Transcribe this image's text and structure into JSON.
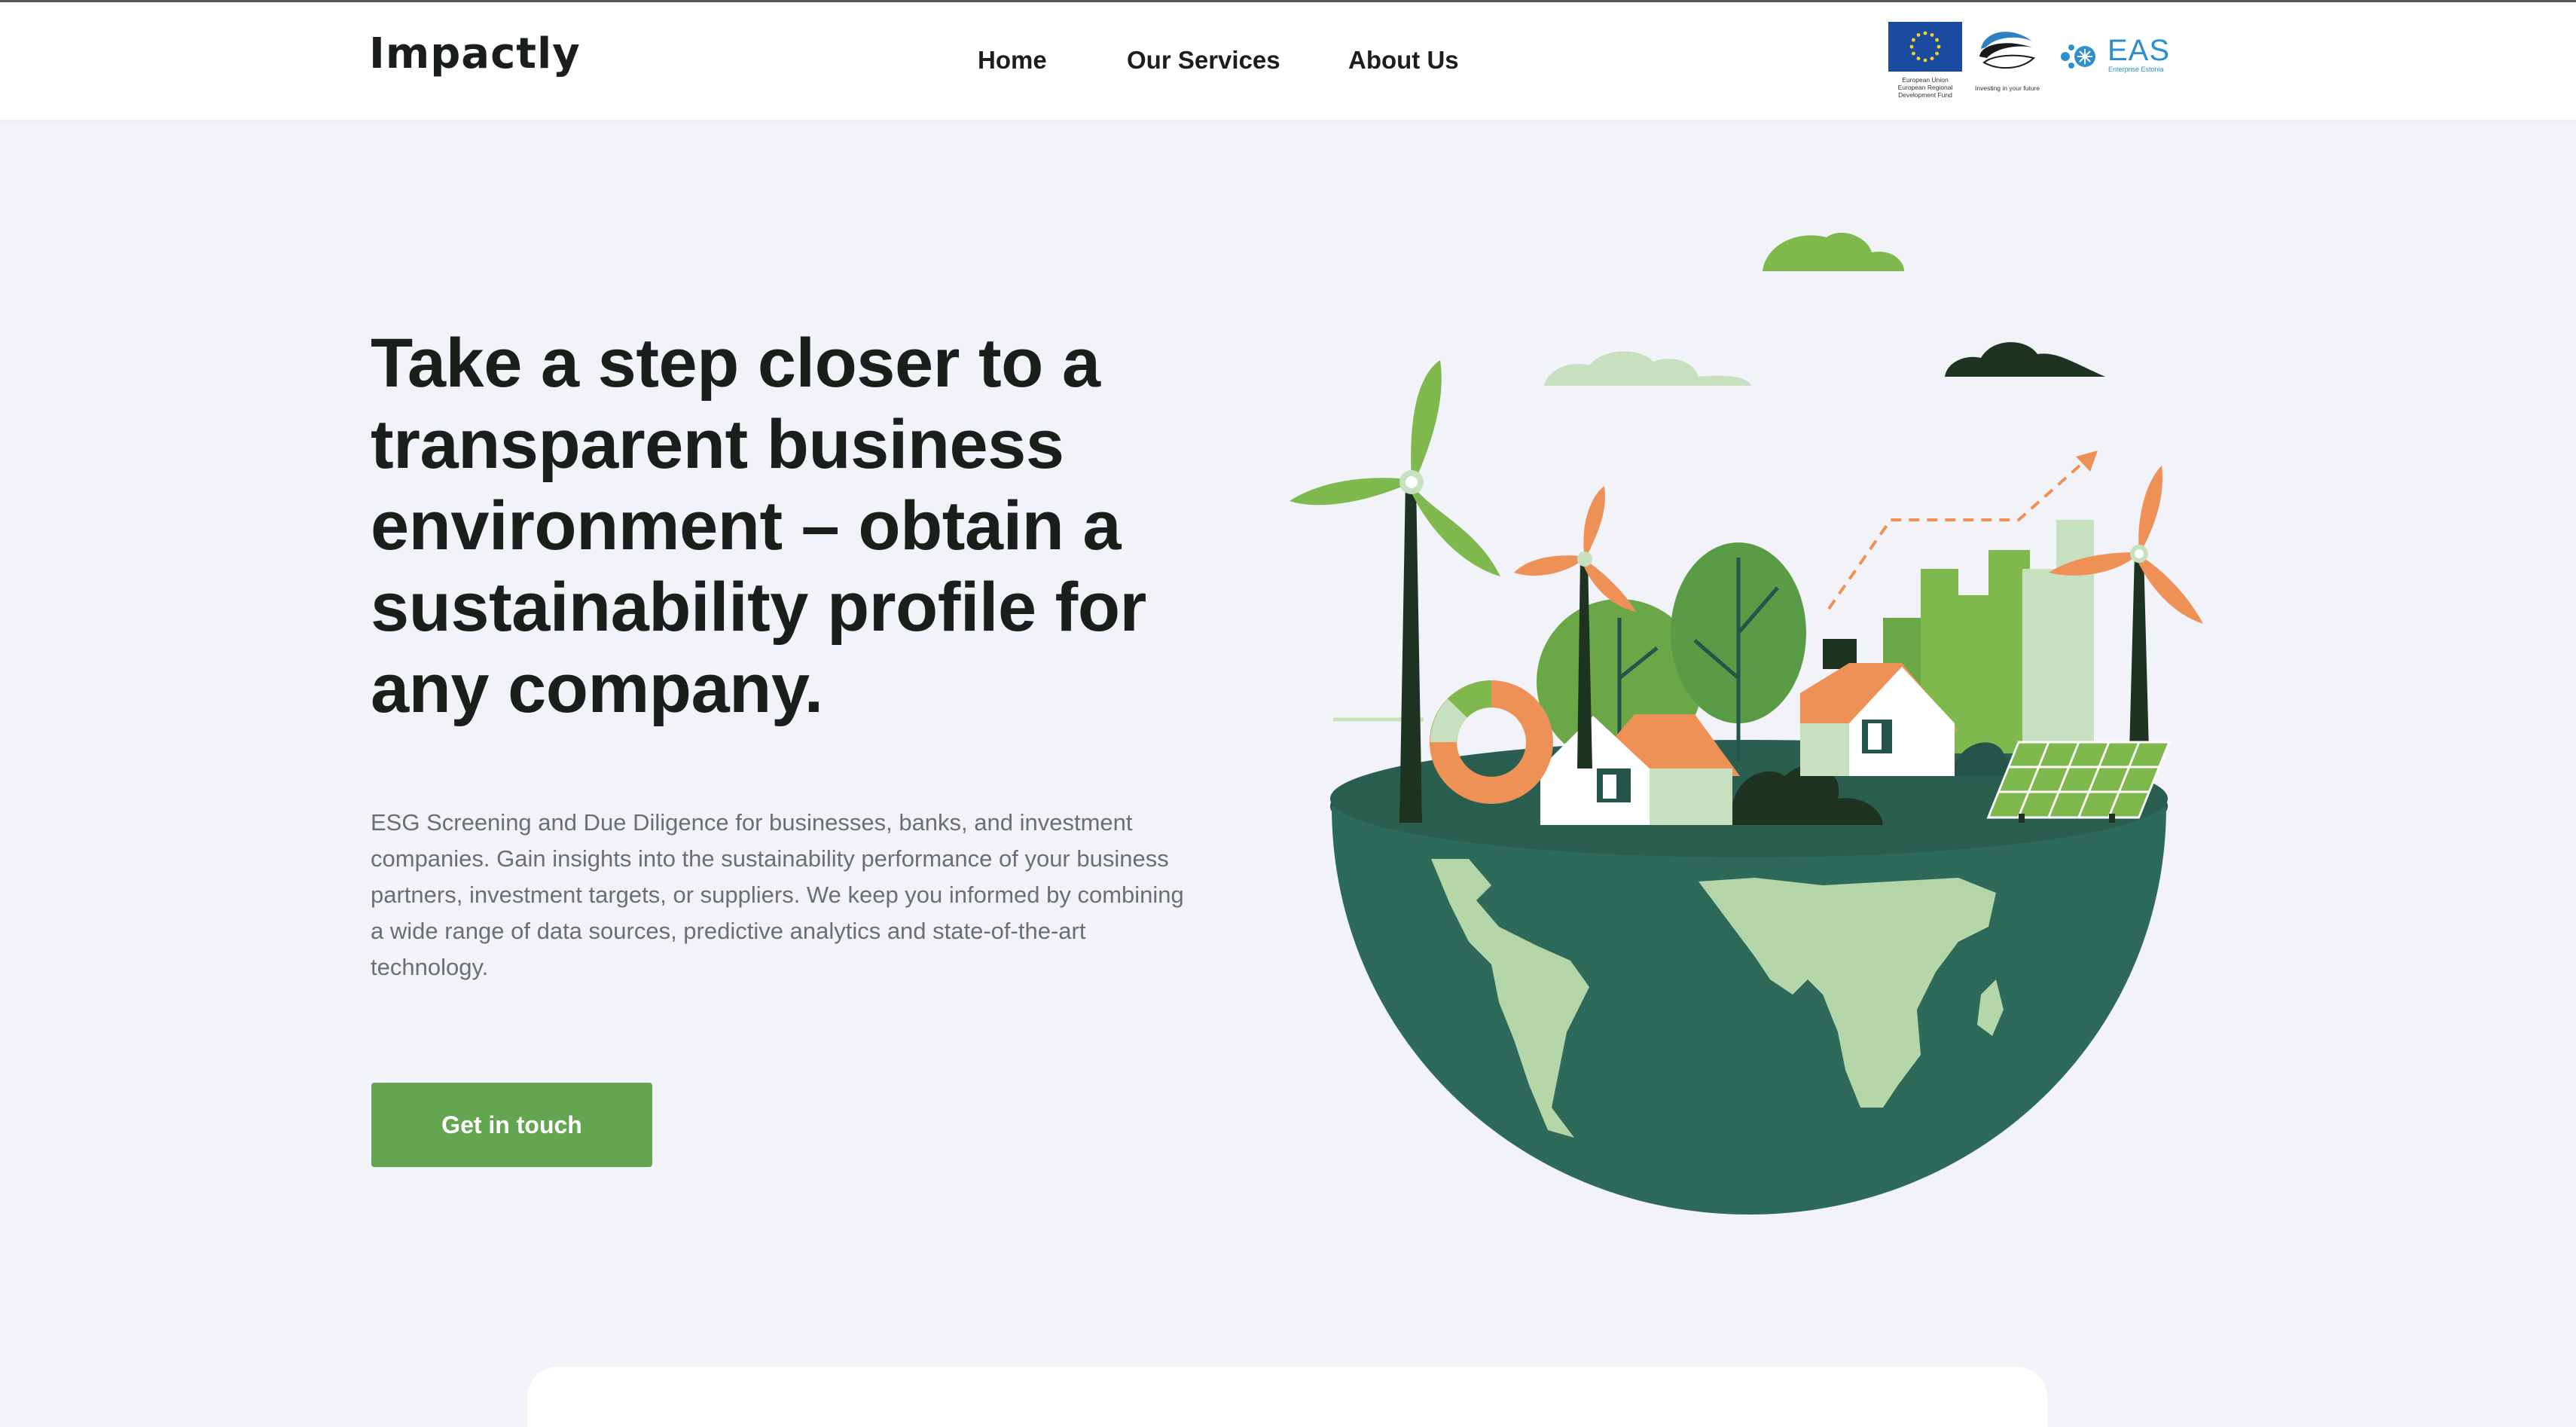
{
  "header": {
    "logo": "Impactly",
    "nav": [
      {
        "label": "Home"
      },
      {
        "label": "Our Services"
      },
      {
        "label": "About Us"
      }
    ],
    "partners": {
      "eu_caption": "European Union European Regional Development Fund",
      "estonia_caption": "Investing in your future",
      "eas_name": "EAS",
      "eas_sub": "Enterprise Estonia"
    }
  },
  "hero": {
    "title": "Take a step closer to a transparent business environment – obtain a sustainability profile for any company.",
    "description": "ESG Screening and Due Diligence for businesses, banks, and investment companies. Gain insights into the sustainability performance of your business partners, investment targets, or suppliers. We keep you informed by combining a wide range of data sources, predictive analytics and state-of-the-art technology.",
    "cta_label": "Get in touch"
  },
  "colors": {
    "accent": "#63a64f",
    "globe": "#2e6a5a",
    "land": "#b3d5a8",
    "orange": "#ee9156"
  }
}
